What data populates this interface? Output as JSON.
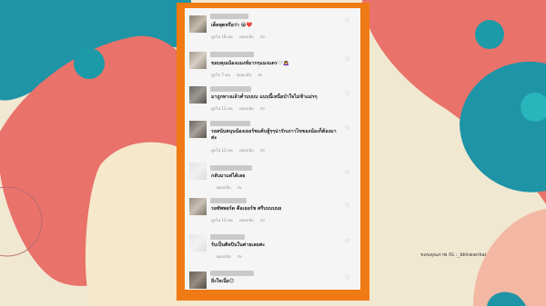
{
  "credit": "ขอบคุณภาพ IG :_bkkwankai",
  "colors": {
    "frame": "#f07a14",
    "panel": "#f5f5f5",
    "teal": "#1f94a6",
    "coral": "#e9726a",
    "peach": "#f2b8a3"
  },
  "comments": [
    {
      "text": "เด็ดสุดหรือว่า 😭❤️",
      "time": "ดูกไป 18 คน",
      "reply": "ตอบกลับ",
      "more": "ส่ง"
    },
    {
      "text": "ขอบคุณน้องแมงห์มากๆแมงแตร🤍🙇‍♀️",
      "time": "ดูกไป 7 คน",
      "reply": "ตอบกลับ",
      "more": "ส่ง"
    },
    {
      "text": "มาถูกทางแล้วค่ำบบบบ แบบนี้เหนื่อบำใจไม่ช้าแม่รๆ",
      "time": "ดูกไป 12 คน",
      "reply": "ตอบกลับ",
      "more": "ส่ง"
    },
    {
      "text": "รอสนับสนุนน้องเธอร์ชแค้บสู้ๆๆน่ารักเถาวไขของน้องก็ต้องมาค่ะ",
      "time": "ดูกไป 12 คน",
      "reply": "ตอบกลับ",
      "more": "ส่ง"
    },
    {
      "text": "กลับมาแต่ได้เลย",
      "time": "",
      "reply": "ตอบกลับ",
      "more": "ส่ง"
    },
    {
      "text": "รอซัพพอร์ต คือเธอร์ช ศรีบบบบบย",
      "time": "ดูกไป 12 คน",
      "reply": "ตอบกลับ",
      "more": "ส่ง"
    },
    {
      "text": "รับเป็นศิลปินในค่ายเลยค่ะ",
      "time": "",
      "reply": "ตอบกลับ",
      "more": "ส่ง"
    },
    {
      "text": "ยิ่งใจเนี่ย😊",
      "time": "",
      "reply": "",
      "more": ""
    }
  ]
}
